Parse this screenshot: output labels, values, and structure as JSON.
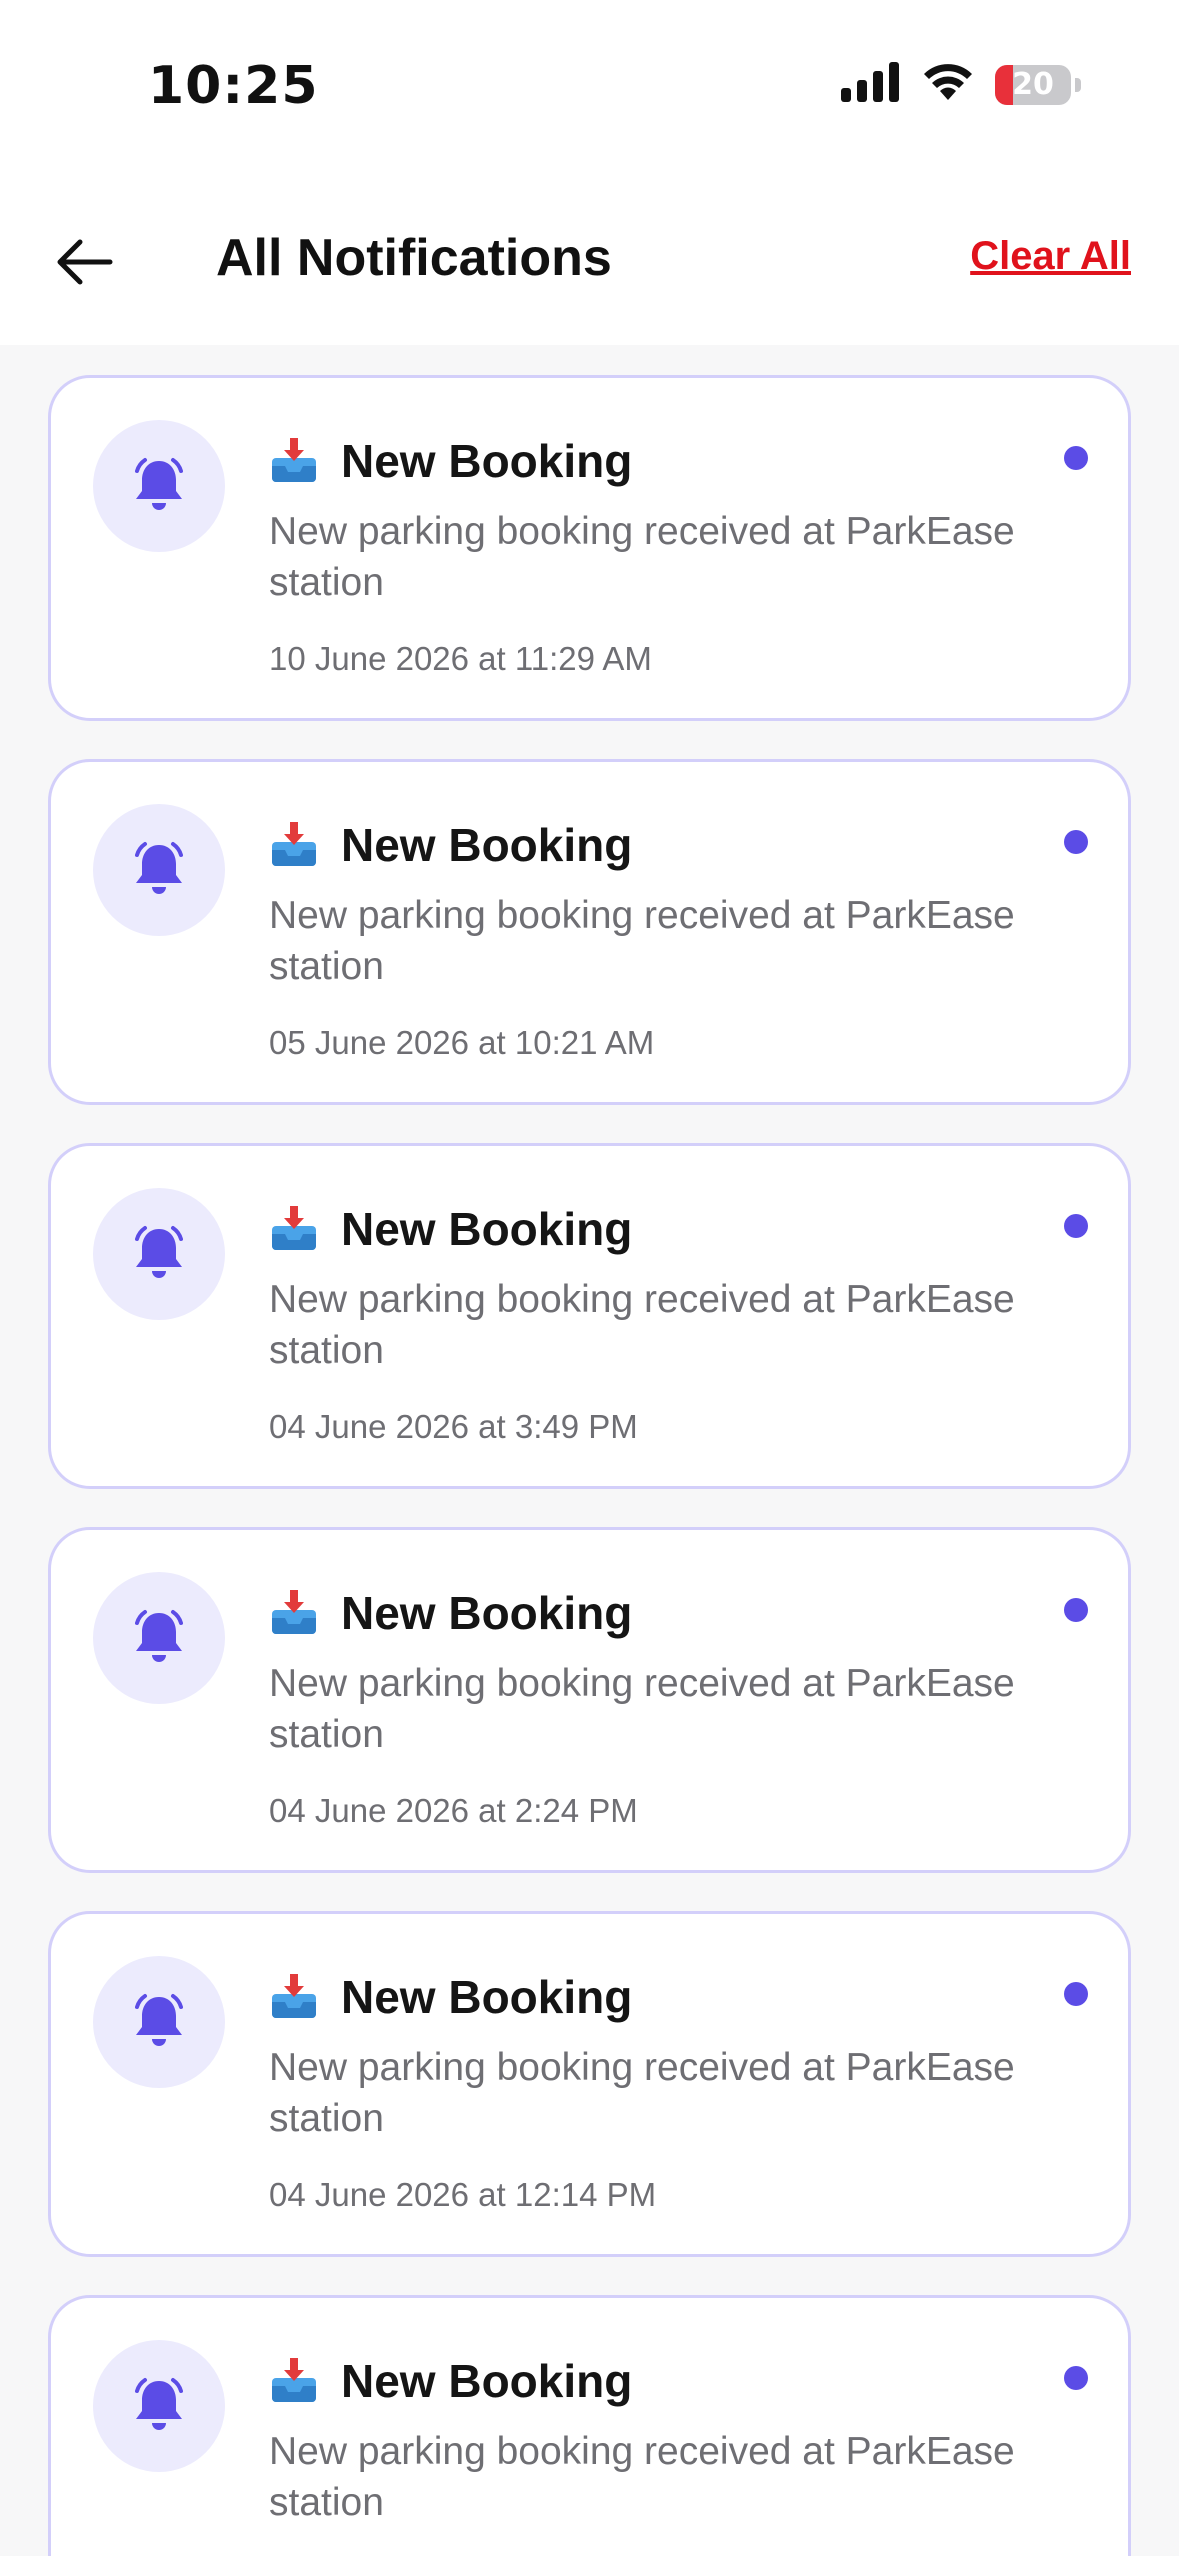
{
  "status_bar": {
    "time": "10:25",
    "battery": "20",
    "icons": [
      "signal-icon",
      "wifi-icon",
      "battery-icon"
    ]
  },
  "header": {
    "title": "All Notifications",
    "clear_all": "Clear All",
    "back_icon": "arrow-left-icon"
  },
  "colors": {
    "accent": "#5b4ce6",
    "danger": "#e0121c",
    "card_border": "#d3cffa",
    "icon_bg": "#ecebfd"
  },
  "notifications": [
    {
      "title": "New Booking",
      "message": "New parking booking received at ParkEase station",
      "time": "10 June 2026 at 11:29 AM",
      "unread": true
    },
    {
      "title": "New Booking",
      "message": "New parking booking received at ParkEase station",
      "time": "05 June 2026 at 10:21 AM",
      "unread": true
    },
    {
      "title": "New Booking",
      "message": "New parking booking received at ParkEase station",
      "time": "04 June 2026 at 3:49 PM",
      "unread": true
    },
    {
      "title": "New Booking",
      "message": "New parking booking received at ParkEase station",
      "time": "04 June 2026 at 2:24 PM",
      "unread": true
    },
    {
      "title": "New Booking",
      "message": "New parking booking received at ParkEase station",
      "time": "04 June 2026 at 12:14 PM",
      "unread": true
    },
    {
      "title": "New Booking",
      "message": "New parking booking received at ParkEase station",
      "time": "",
      "unread": true
    }
  ]
}
